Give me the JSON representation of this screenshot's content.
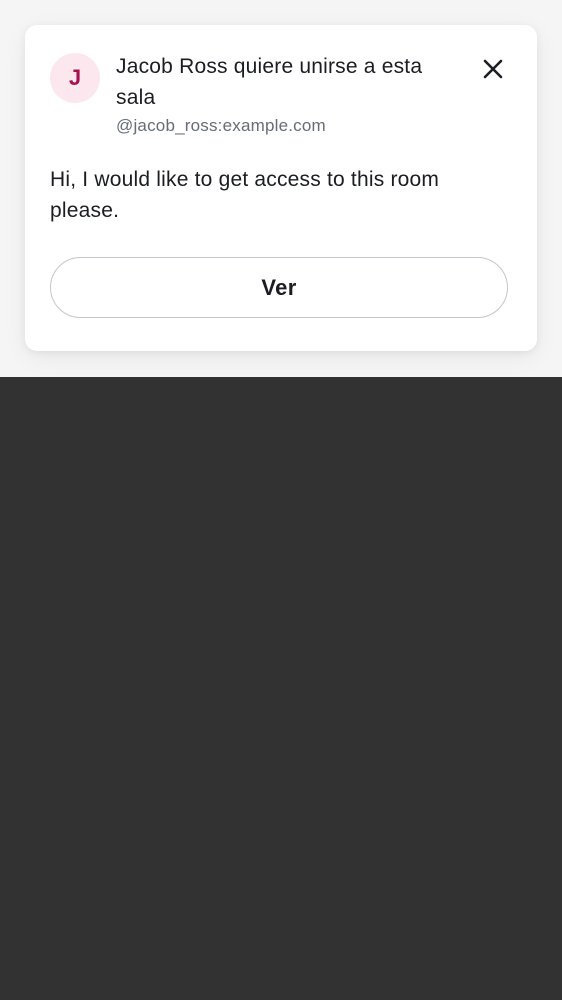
{
  "notification": {
    "avatar_initial": "J",
    "title": "Jacob Ross quiere unirse a esta sala",
    "user_id": "@jacob_ross:example.com",
    "message": "Hi, I would like to get access to this room please.",
    "view_label": "Ver",
    "close_icon": "close-icon"
  },
  "colors": {
    "avatar_bg": "#fde7ee",
    "avatar_text": "#a5124f",
    "text_primary": "#1b1d22",
    "text_secondary": "#656d77",
    "button_border": "#c3c6cc",
    "backdrop_top": "#f5f5f5",
    "backdrop_bottom": "#323232"
  }
}
